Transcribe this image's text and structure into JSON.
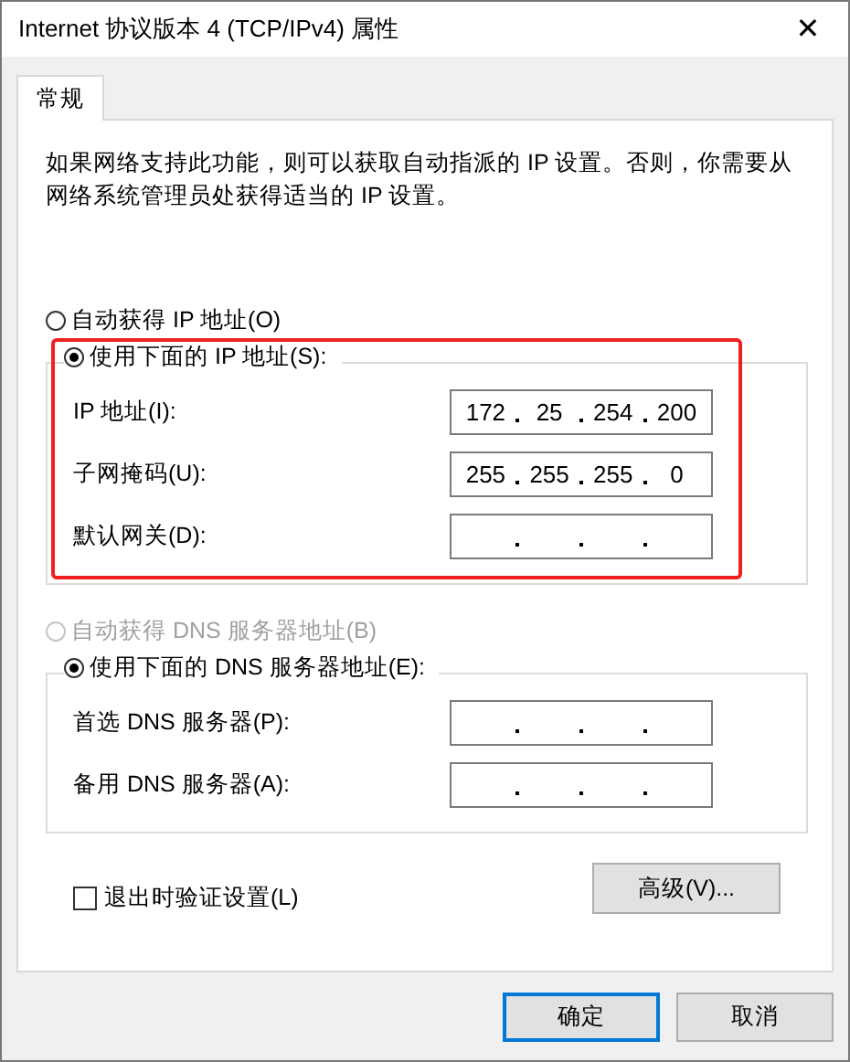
{
  "window": {
    "title": "Internet 协议版本 4 (TCP/IPv4) 属性",
    "close": "✕"
  },
  "tabs": [
    {
      "label": "常规",
      "selected": true
    }
  ],
  "description": "如果网络支持此功能，则可以获取自动指派的 IP 设置。否则，你需要从网络系统管理员处获得适当的 IP 设置。",
  "ip_section": {
    "auto_option": {
      "label": "自动获得 IP 地址(O)",
      "selected": false,
      "disabled": false
    },
    "manual_option": {
      "label": "使用下面的 IP 地址(S):",
      "selected": true
    },
    "highlighted": true,
    "fields": [
      {
        "label": "IP 地址(I):",
        "octets": [
          "172",
          "25",
          "254",
          "200"
        ]
      },
      {
        "label": "子网掩码(U):",
        "octets": [
          "255",
          "255",
          "255",
          "0"
        ]
      },
      {
        "label": "默认网关(D):"
      }
    ]
  },
  "dns_section": {
    "auto_option": {
      "label": "自动获得 DNS 服务器地址(B)",
      "selected": false,
      "disabled": true
    },
    "manual_option": {
      "label": "使用下面的 DNS 服务器地址(E):",
      "selected": true
    },
    "fields": [
      {
        "label": "首选 DNS 服务器(P):"
      },
      {
        "label": "备用 DNS 服务器(A):"
      }
    ]
  },
  "validate_checkbox": {
    "label": "退出时验证设置(L)",
    "checked": false
  },
  "advanced_button": "高级(V)...",
  "buttons": [
    {
      "label": "确定",
      "default": true
    },
    {
      "label": "取消",
      "default": false
    }
  ]
}
